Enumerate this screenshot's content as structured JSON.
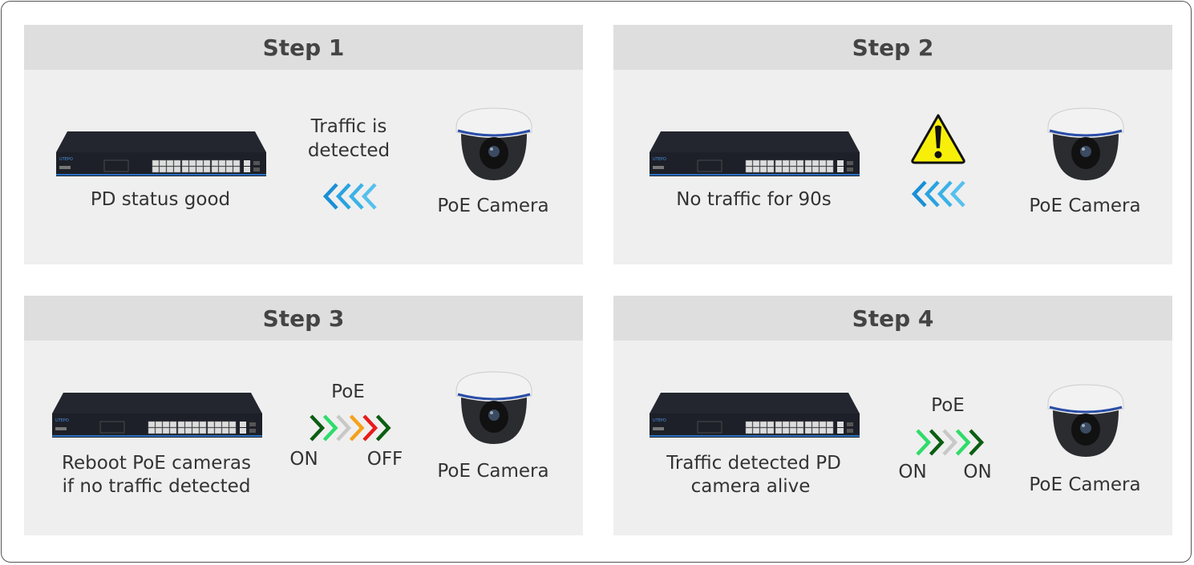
{
  "steps": [
    {
      "title": "Step 1",
      "device_label": "PD status good",
      "middle_text": [
        "Traffic is",
        "detected"
      ],
      "camera_label": "PoE Camera",
      "icon": "left-chevrons-traffic",
      "chevron_colors": [
        "#1a8fd6",
        "#29a3e0",
        "#3bb2e8",
        "#55c0ee"
      ]
    },
    {
      "title": "Step 2",
      "device_label": "No traffic for 90s",
      "warning_icon": "warning-triangle",
      "camera_label": "PoE Camera",
      "icon": "left-chevrons-traffic",
      "chevron_colors": [
        "#1a8fd6",
        "#29a3e0",
        "#3bb2e8",
        "#55c0ee"
      ]
    },
    {
      "title": "Step 3",
      "device_label": [
        "Reboot PoE cameras",
        "if no traffic detected"
      ],
      "poe_label": "PoE",
      "left_state": "ON",
      "right_state": "OFF",
      "camera_label": "PoE Camera",
      "icon": "right-chevrons-power",
      "chevron_colors": [
        "#0b5e12",
        "#2edc6a",
        "#c8c8c8",
        "#f5a11c",
        "#e81b1b",
        "#0b5e12"
      ]
    },
    {
      "title": "Step 4",
      "device_label": [
        "Traffic detected PD",
        "camera alive"
      ],
      "poe_label": "PoE",
      "left_state": "ON",
      "right_state": "ON",
      "camera_label": "PoE Camera",
      "icon": "right-chevrons-power",
      "chevron_colors": [
        "#2edc6a",
        "#0b5e12",
        "#c8c8c8",
        "#2edc6a",
        "#0b5e12"
      ]
    }
  ],
  "switch_brand": "UTEPO"
}
